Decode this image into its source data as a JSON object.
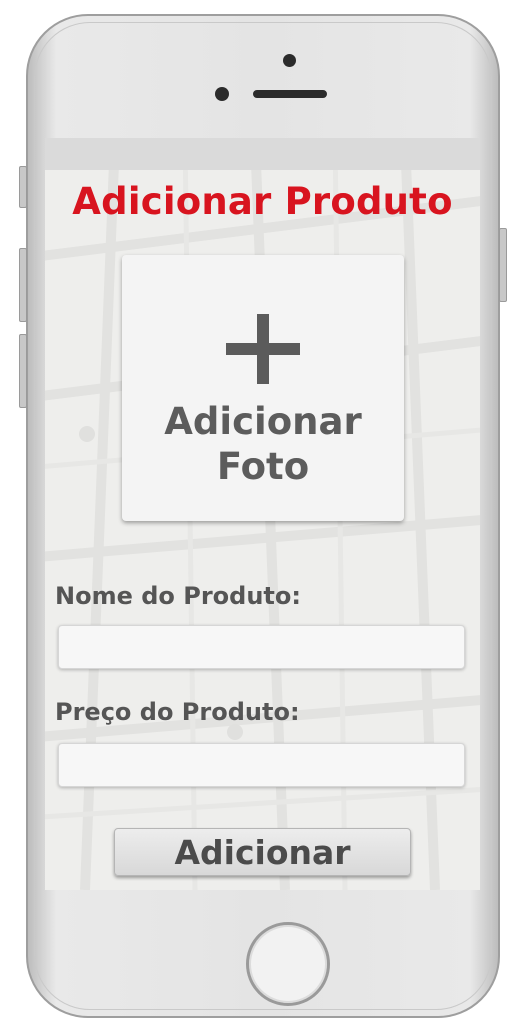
{
  "screen": {
    "title": "Adicionar Produto",
    "photo_button": {
      "icon": "plus-icon",
      "label": "Adicionar\nFoto"
    },
    "name_field": {
      "label": "Nome do Produto:",
      "value": ""
    },
    "price_field": {
      "label": "Preço do Produto:",
      "value": ""
    },
    "submit_label": "Adicionar"
  },
  "colors": {
    "title": "#d8141f",
    "label": "#555555",
    "screen_bg": "#eeeeec"
  }
}
